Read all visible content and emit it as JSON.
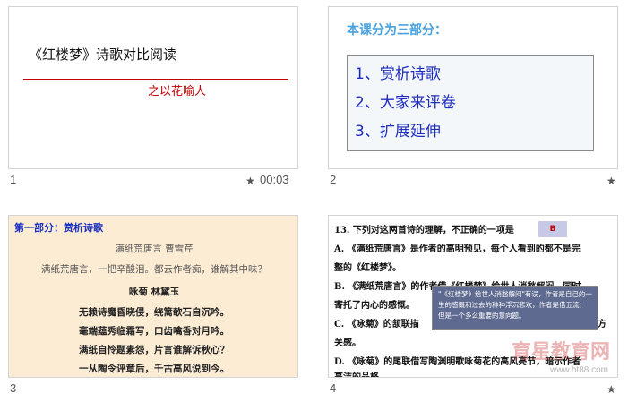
{
  "slides": [
    {
      "number": "1",
      "title": "《红楼梦》诗歌对比阅读",
      "subtitle": "之以花喻人",
      "timing": "00:03",
      "star": "★"
    },
    {
      "number": "2",
      "heading": "本课分为三部分：",
      "items": [
        "1、赏析诗歌",
        "2、大家来评卷",
        "3、扩展延伸"
      ],
      "star": "★"
    },
    {
      "number": "3",
      "heading": "第一部分：赏析诗歌",
      "lines": [
        "满纸荒唐言    曹雪芹",
        "满纸荒唐言，一把辛酸泪。都云作者痴，谁解其中味？",
        "咏菊    林黛玉",
        "无赖诗魔昏晓侵，绕篱欹石自沉吟。",
        "毫端蕴秀临霜写，口齿噙香对月吟。",
        "满纸自怜题素怨，片言谁解诉秋心？",
        "一从陶令评章后，千古高风说到今。"
      ]
    },
    {
      "number": "4",
      "questions": [
        "13. 下列对这两首诗的理解，不正确的一项是",
        "A. 《满纸荒唐言》是作者的高明预见，每个人看到的都不是完",
        "整的《红楼梦》。",
        "B. 《满纸荒唐言》的作者借《红楼梦》给世人消愁解闷，同时",
        "寄托了内心的感慨。",
        "C. 《咏菊》的颔联描",
        "关感。",
        "D. 《咏菊》的尾联借写陶渊明歌咏菊花的高风亮节，暗示作者",
        "高洁的品格。"
      ],
      "answer": "B",
      "note": "\"《红楼梦》给世人消愁解闷\"有误，作者是自己的一生的感慨和过去的种种浮沉悲欢，作者是借五流，但是一个多么重要的意向题。",
      "c_tail": "方",
      "watermark": "育星教育网",
      "watermark_url": "www.ht88.com",
      "star": "★"
    }
  ]
}
